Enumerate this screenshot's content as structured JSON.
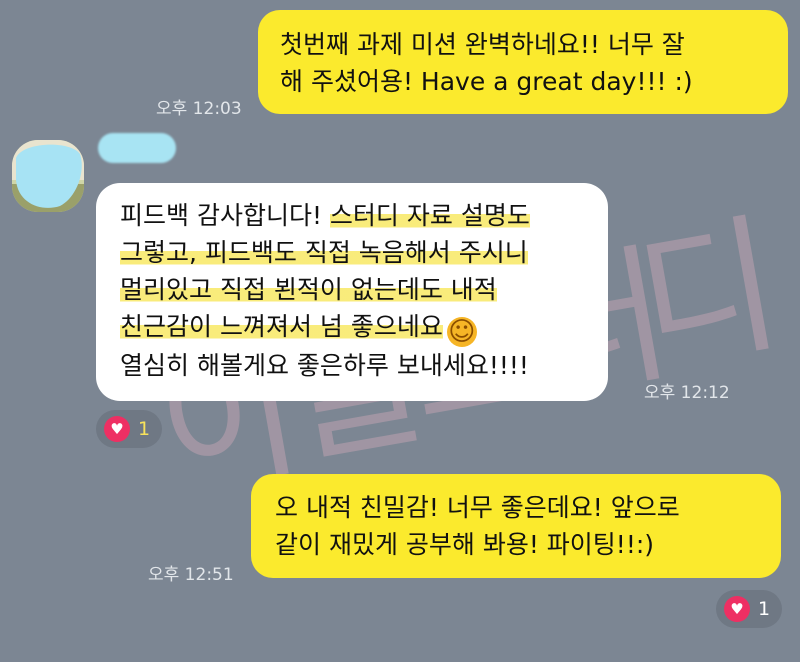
{
  "colors": {
    "background": "#7c8693",
    "sent_bubble": "#fbea2d",
    "received_bubble": "#ffffff",
    "highlight": "#f8e864",
    "reaction_heart": "#ee2f63",
    "watermark": "#ffbecd"
  },
  "watermark_text": [
    "이",
    "첼",
    "스",
    "터",
    "디"
  ],
  "messages": [
    {
      "direction": "sent",
      "lines": [
        "첫번째 과제 미션 완벽하네요!! 너무 잘",
        "해 주셨어용! Have a great day!!! :)"
      ],
      "time": "오후 12:03"
    },
    {
      "direction": "received",
      "line1_plain": "피드백 감사합니다! ",
      "line1_hl": "스터디 자료 설명도",
      "line2_hl": "그렇고, 피드백도 직접 녹음해서 주시니",
      "line3_hl": "멀리있고 직접 뵌적이 없는데도 내적",
      "line4_hl": "친근감이 느껴져서 넘 좋으네요",
      "line4_emoji": "☺",
      "line5": "열심히 해볼게요 좋은하루 보내세요!!!!",
      "time": "오후 12:12",
      "reaction": {
        "icon": "heart-icon",
        "count": "1"
      }
    },
    {
      "direction": "sent",
      "lines": [
        "오 내적 친밀감!  너무 좋은데요! 앞으로",
        "같이 재밌게 공부해 봐용! 파이팅!!:)"
      ],
      "time": "오후 12:51",
      "reaction": {
        "icon": "heart-icon",
        "count": "1"
      }
    }
  ]
}
